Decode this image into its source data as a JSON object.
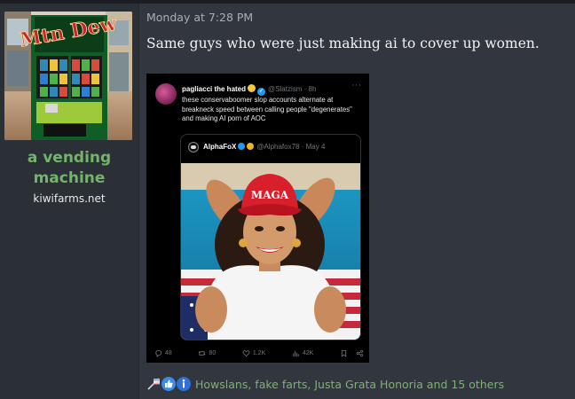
{
  "author": {
    "username": "a vending machine",
    "user_title": "kiwifarms.net",
    "avatar": {
      "brand_text": "Mtn Dew",
      "description_icon": "vending-machine-avatar"
    }
  },
  "post": {
    "timestamp": "Monday at 7:28 PM",
    "text": "Same guys who were just making ai to cover up women.",
    "embed": {
      "tweet": {
        "display_name": "pagliacci the hated",
        "handle_time": "@Slatzism · 8h",
        "body": "these conservaboomer slop accounts alternate at breakneck speed between calling people \"degenerates\" and making AI porn of AOC"
      },
      "quoted_tweet": {
        "display_name": "AlphaFoX",
        "handle_time": "@Alphafox78 · May 4",
        "image_hat_text": "MAGA"
      },
      "actions": {
        "replies": "48",
        "retweets": "80",
        "likes": "1.2K",
        "views": "42K"
      }
    }
  },
  "reactions": {
    "icons": [
      "trans-flag-icon",
      "thumbs-up-icon",
      "informative-icon"
    ],
    "summary": "Howslans, fake farts, Justa Grata Honoria and 15 others"
  },
  "colors": {
    "username": "#74b36b",
    "reaction_link": "#7bb36f",
    "post_bg": "#32363e",
    "sidebar_bg": "#2b2f36"
  }
}
